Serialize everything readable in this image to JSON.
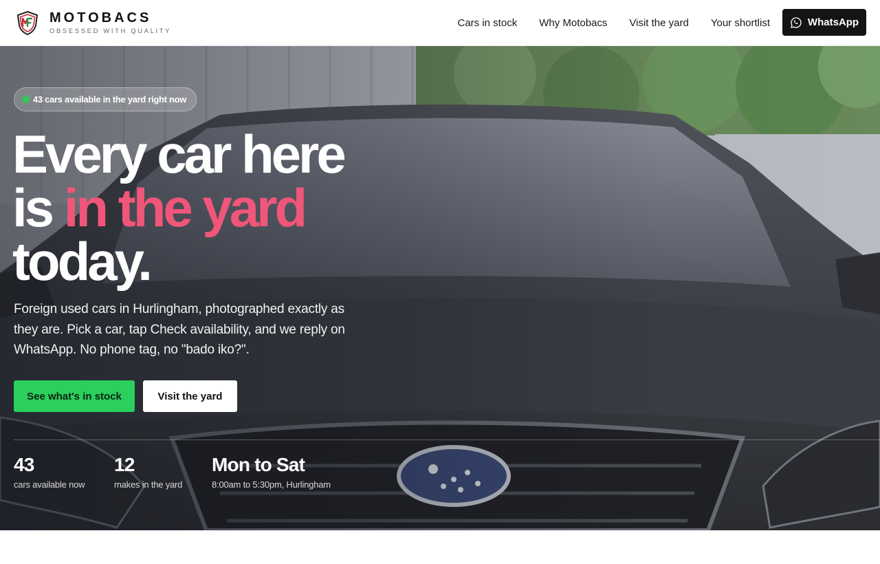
{
  "header": {
    "brand_name": "MOTOBACS",
    "brand_tagline": "OBSESSED WITH QUALITY",
    "nav": [
      {
        "label": "Cars in stock"
      },
      {
        "label": "Why Motobacs"
      },
      {
        "label": "Visit the yard"
      },
      {
        "label": "Your shortlist"
      }
    ],
    "whatsapp_label": "WhatsApp"
  },
  "hero": {
    "availability_pill": "43 cars available in the yard right now",
    "headline_line1": "Every car here",
    "headline_line2_prefix": "is ",
    "headline_line2_accent": "in the yard",
    "headline_line3": "today.",
    "subcopy": "Foreign used cars in Hurlingham, photographed exactly as they are. Pick a car, tap Check availability, and we reply on WhatsApp. No phone tag, no \"bado iko?\".",
    "cta_primary": "See what's in stock",
    "cta_secondary": "Visit the yard",
    "stats": [
      {
        "value": "43",
        "label": "cars available now"
      },
      {
        "value": "12",
        "label": "makes in the yard"
      },
      {
        "value": "Mon to Sat",
        "label": "8:00am to 5:30pm, Hurlingham"
      }
    ]
  },
  "colors": {
    "accent_pink": "#f0567a",
    "cta_green": "#2bcf5b",
    "status_green": "#2ecc55",
    "header_button": "#141414"
  },
  "icons": {
    "logo": "motobacs-shield-logo",
    "whatsapp": "whatsapp-icon",
    "status": "status-dot-icon"
  }
}
